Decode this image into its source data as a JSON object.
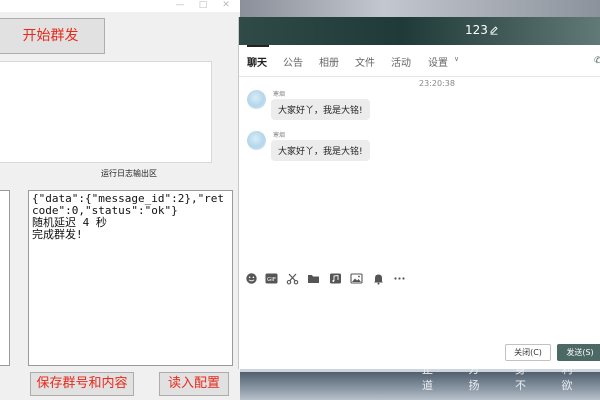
{
  "left_app": {
    "start_button": "开始群发",
    "log_caption": "运行日志输出区",
    "log_lines": [
      "{\"data\":{\"message_id\":2},\"retcode\":0,\"status\":\"ok\"}",
      "随机延迟 4 秒",
      "完成群发!"
    ],
    "save_button": "保存群号和内容",
    "load_button": "读入配置"
  },
  "chat": {
    "title": "123",
    "tabs": [
      "聊天",
      "公告",
      "相册",
      "文件",
      "活动",
      "设置"
    ],
    "time": "23:20:38",
    "messages": [
      {
        "sender": "寒烟",
        "text": "大家好丫，我是大铭!"
      },
      {
        "sender": "寒烟",
        "text": "大家好丫，我是大铭!"
      }
    ],
    "toolbar_gif": "GIF",
    "close_button": "关闭(C)",
    "send_button": "发送(S)"
  },
  "wallpaper": {
    "poem": "止 方 身 利\n道 扬 不 欲"
  },
  "colors": {
    "accent": "#4c6965",
    "button_text_red": "#e8291c",
    "bubble_bg": "#ececec"
  },
  "icons": [
    "edit-icon",
    "emoji-icon",
    "gif-icon",
    "scissors-icon",
    "folder-icon",
    "music-icon",
    "image-icon",
    "bell-icon",
    "more-icon",
    "minimize-icon",
    "maximize-icon",
    "close-icon"
  ]
}
